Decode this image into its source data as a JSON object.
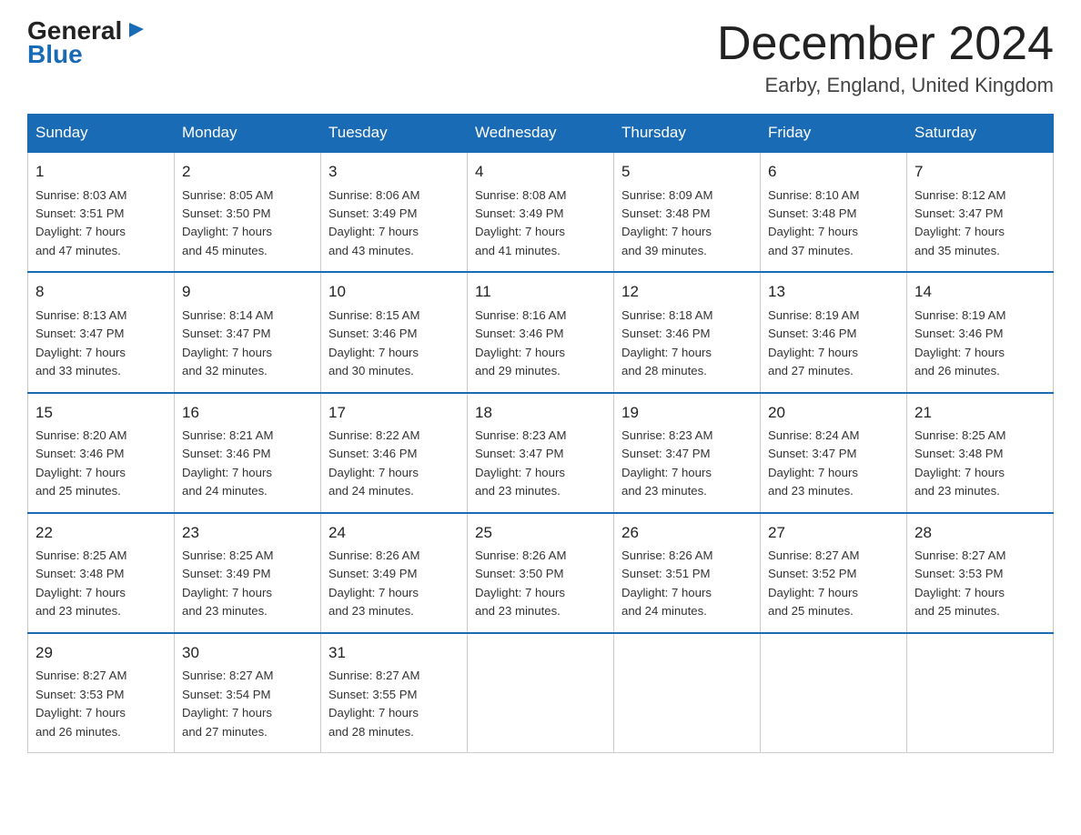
{
  "logo": {
    "part1": "General",
    "triangle": "▶",
    "part2": "Blue"
  },
  "title": "December 2024",
  "location": "Earby, England, United Kingdom",
  "headers": [
    "Sunday",
    "Monday",
    "Tuesday",
    "Wednesday",
    "Thursday",
    "Friday",
    "Saturday"
  ],
  "weeks": [
    [
      {
        "day": "1",
        "info": "Sunrise: 8:03 AM\nSunset: 3:51 PM\nDaylight: 7 hours\nand 47 minutes."
      },
      {
        "day": "2",
        "info": "Sunrise: 8:05 AM\nSunset: 3:50 PM\nDaylight: 7 hours\nand 45 minutes."
      },
      {
        "day": "3",
        "info": "Sunrise: 8:06 AM\nSunset: 3:49 PM\nDaylight: 7 hours\nand 43 minutes."
      },
      {
        "day": "4",
        "info": "Sunrise: 8:08 AM\nSunset: 3:49 PM\nDaylight: 7 hours\nand 41 minutes."
      },
      {
        "day": "5",
        "info": "Sunrise: 8:09 AM\nSunset: 3:48 PM\nDaylight: 7 hours\nand 39 minutes."
      },
      {
        "day": "6",
        "info": "Sunrise: 8:10 AM\nSunset: 3:48 PM\nDaylight: 7 hours\nand 37 minutes."
      },
      {
        "day": "7",
        "info": "Sunrise: 8:12 AM\nSunset: 3:47 PM\nDaylight: 7 hours\nand 35 minutes."
      }
    ],
    [
      {
        "day": "8",
        "info": "Sunrise: 8:13 AM\nSunset: 3:47 PM\nDaylight: 7 hours\nand 33 minutes."
      },
      {
        "day": "9",
        "info": "Sunrise: 8:14 AM\nSunset: 3:47 PM\nDaylight: 7 hours\nand 32 minutes."
      },
      {
        "day": "10",
        "info": "Sunrise: 8:15 AM\nSunset: 3:46 PM\nDaylight: 7 hours\nand 30 minutes."
      },
      {
        "day": "11",
        "info": "Sunrise: 8:16 AM\nSunset: 3:46 PM\nDaylight: 7 hours\nand 29 minutes."
      },
      {
        "day": "12",
        "info": "Sunrise: 8:18 AM\nSunset: 3:46 PM\nDaylight: 7 hours\nand 28 minutes."
      },
      {
        "day": "13",
        "info": "Sunrise: 8:19 AM\nSunset: 3:46 PM\nDaylight: 7 hours\nand 27 minutes."
      },
      {
        "day": "14",
        "info": "Sunrise: 8:19 AM\nSunset: 3:46 PM\nDaylight: 7 hours\nand 26 minutes."
      }
    ],
    [
      {
        "day": "15",
        "info": "Sunrise: 8:20 AM\nSunset: 3:46 PM\nDaylight: 7 hours\nand 25 minutes."
      },
      {
        "day": "16",
        "info": "Sunrise: 8:21 AM\nSunset: 3:46 PM\nDaylight: 7 hours\nand 24 minutes."
      },
      {
        "day": "17",
        "info": "Sunrise: 8:22 AM\nSunset: 3:46 PM\nDaylight: 7 hours\nand 24 minutes."
      },
      {
        "day": "18",
        "info": "Sunrise: 8:23 AM\nSunset: 3:47 PM\nDaylight: 7 hours\nand 23 minutes."
      },
      {
        "day": "19",
        "info": "Sunrise: 8:23 AM\nSunset: 3:47 PM\nDaylight: 7 hours\nand 23 minutes."
      },
      {
        "day": "20",
        "info": "Sunrise: 8:24 AM\nSunset: 3:47 PM\nDaylight: 7 hours\nand 23 minutes."
      },
      {
        "day": "21",
        "info": "Sunrise: 8:25 AM\nSunset: 3:48 PM\nDaylight: 7 hours\nand 23 minutes."
      }
    ],
    [
      {
        "day": "22",
        "info": "Sunrise: 8:25 AM\nSunset: 3:48 PM\nDaylight: 7 hours\nand 23 minutes."
      },
      {
        "day": "23",
        "info": "Sunrise: 8:25 AM\nSunset: 3:49 PM\nDaylight: 7 hours\nand 23 minutes."
      },
      {
        "day": "24",
        "info": "Sunrise: 8:26 AM\nSunset: 3:49 PM\nDaylight: 7 hours\nand 23 minutes."
      },
      {
        "day": "25",
        "info": "Sunrise: 8:26 AM\nSunset: 3:50 PM\nDaylight: 7 hours\nand 23 minutes."
      },
      {
        "day": "26",
        "info": "Sunrise: 8:26 AM\nSunset: 3:51 PM\nDaylight: 7 hours\nand 24 minutes."
      },
      {
        "day": "27",
        "info": "Sunrise: 8:27 AM\nSunset: 3:52 PM\nDaylight: 7 hours\nand 25 minutes."
      },
      {
        "day": "28",
        "info": "Sunrise: 8:27 AM\nSunset: 3:53 PM\nDaylight: 7 hours\nand 25 minutes."
      }
    ],
    [
      {
        "day": "29",
        "info": "Sunrise: 8:27 AM\nSunset: 3:53 PM\nDaylight: 7 hours\nand 26 minutes."
      },
      {
        "day": "30",
        "info": "Sunrise: 8:27 AM\nSunset: 3:54 PM\nDaylight: 7 hours\nand 27 minutes."
      },
      {
        "day": "31",
        "info": "Sunrise: 8:27 AM\nSunset: 3:55 PM\nDaylight: 7 hours\nand 28 minutes."
      },
      null,
      null,
      null,
      null
    ]
  ]
}
